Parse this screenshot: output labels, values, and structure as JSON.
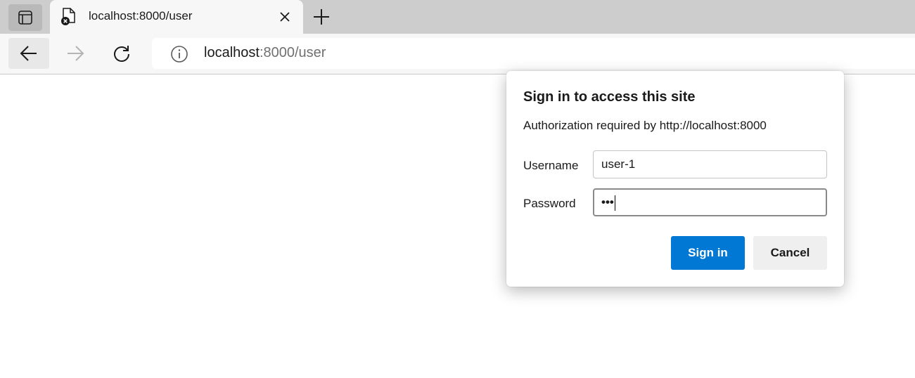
{
  "tab": {
    "title": "localhost:8000/user"
  },
  "address_bar": {
    "host": "localhost",
    "path": ":8000/user"
  },
  "auth_dialog": {
    "title": "Sign in to access this site",
    "description": "Authorization required by http://localhost:8000",
    "username_label": "Username",
    "username_value": "user-1",
    "password_label": "Password",
    "password_masked": "•••",
    "sign_in_label": "Sign in",
    "cancel_label": "Cancel"
  },
  "colors": {
    "primary_button": "#0078d4",
    "tabstrip": "#cdcdcd",
    "toolbar": "#f7f7f7"
  }
}
